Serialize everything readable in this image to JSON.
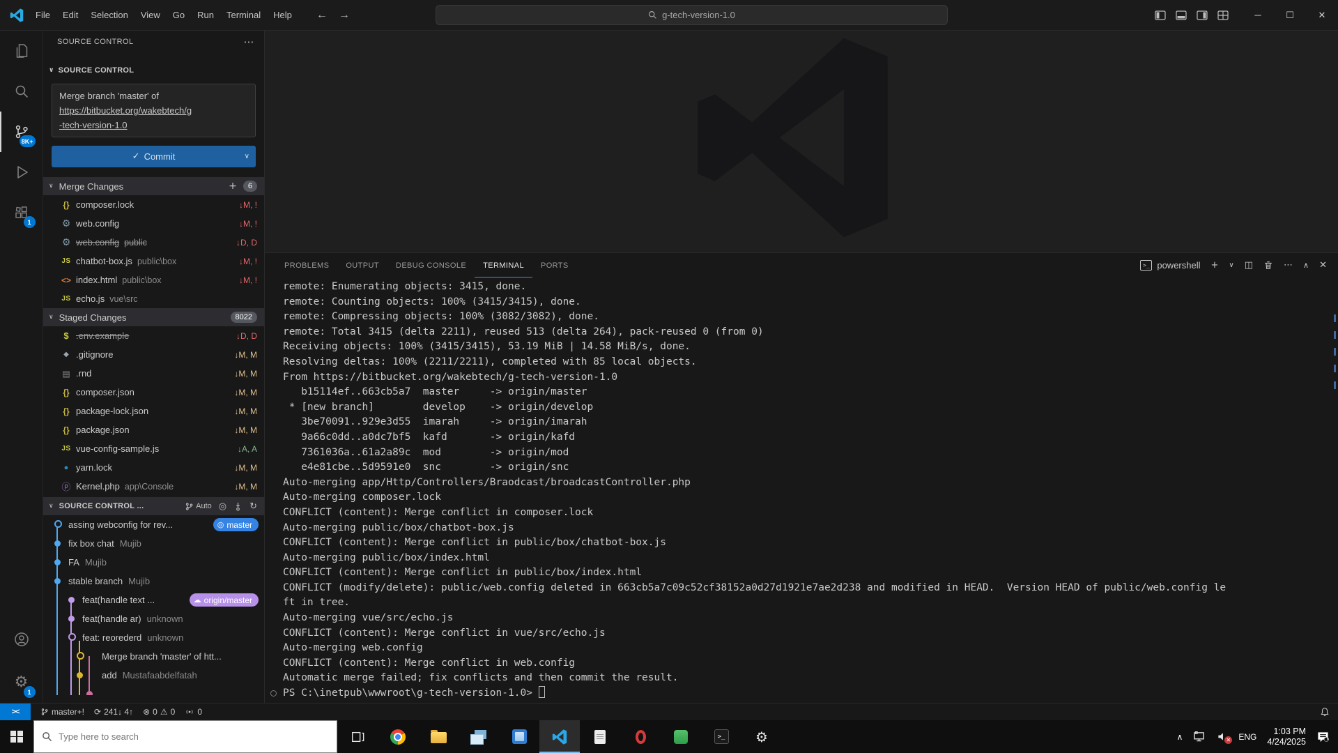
{
  "menus": [
    "File",
    "Edit",
    "Selection",
    "View",
    "Go",
    "Run",
    "Terminal",
    "Help"
  ],
  "window": {
    "search_value": "g-tech-version-1.0"
  },
  "glyphs": {
    "check": "✓",
    "chevron_down": "∨",
    "chevron_up": "∧",
    "more": "⋯",
    "add": "+",
    "back": "←",
    "forward": "→",
    "refresh": "↻",
    "target": "◎",
    "cloud": "☁",
    "gear": "⚙",
    "warning": "⚠",
    "error_circle": "⊗",
    "sync": "⟳",
    "close": "✕",
    "minimize": "─",
    "maximize": "☐",
    "split": "◫",
    "cmd_prompt": ">_"
  },
  "file_icons": {
    "braces": "{}",
    "gear": "⚙",
    "js": "JS",
    "html": "<>",
    "dollar": "$",
    "git": "◆",
    "file": "▤",
    "yarn": "●",
    "php": "ⓟ"
  },
  "colors": {
    "accent": "#0078d4",
    "conflict": "#e4676b",
    "deleted": "#e4676b",
    "modified": "#e2c08d",
    "added": "#81b88b",
    "ref_blue": "#3584e4",
    "ref_purple": "#b790ea",
    "lane_blue": "#4fa8f0",
    "lane_purple": "#c09aeb",
    "lane_yellow": "#ddb62f",
    "lane_magenta": "#d16d9e"
  },
  "activity_bar": {
    "scm_badge": "8K+",
    "extensions_badge": "1",
    "settings_badge": "1"
  },
  "sidebar": {
    "panel_title": "SOURCE CONTROL",
    "section_label": "SOURCE CONTROL",
    "commit_message": [
      "Merge branch 'master' of",
      "https://bitbucket.org/wakebtech/g",
      "-tech-version-1.0"
    ],
    "commit_button_label": "Commit",
    "sections": [
      {
        "label": "Merge Changes",
        "badge": "6",
        "show_add": true,
        "files": [
          {
            "icon": "braces",
            "name": "composer.lock",
            "desc": "",
            "marker": "↓M, !",
            "status": "conflict",
            "strike": false
          },
          {
            "icon": "gear",
            "name": "web.config",
            "desc": "",
            "marker": "↓M, !",
            "status": "conflict",
            "strike": false
          },
          {
            "icon": "gear",
            "name": "web.config",
            "desc": "public",
            "marker": "↓D, D",
            "status": "deleted",
            "strike": true
          },
          {
            "icon": "js",
            "name": "chatbot-box.js",
            "desc": "public\\box",
            "marker": "↓M, !",
            "status": "conflict",
            "strike": false
          },
          {
            "icon": "html",
            "name": "index.html",
            "desc": "public\\box",
            "marker": "↓M, !",
            "status": "conflict",
            "strike": false
          },
          {
            "icon": "js",
            "name": "echo.js",
            "desc": "vue\\src",
            "marker": "",
            "status": "none",
            "strike": false
          }
        ]
      },
      {
        "label": "Staged Changes",
        "badge": "8022",
        "show_add": false,
        "files": [
          {
            "icon": "dollar",
            "name": ".env.example",
            "desc": "",
            "marker": "↓D, D",
            "status": "deleted",
            "strike": true
          },
          {
            "icon": "git",
            "name": ".gitignore",
            "desc": "",
            "marker": "↓M, M",
            "status": "modified",
            "strike": false
          },
          {
            "icon": "file",
            "name": ".rnd",
            "desc": "",
            "marker": "↓M, M",
            "status": "modified",
            "strike": false
          },
          {
            "icon": "braces",
            "name": "composer.json",
            "desc": "",
            "marker": "↓M, M",
            "status": "modified",
            "strike": false
          },
          {
            "icon": "braces",
            "name": "package-lock.json",
            "desc": "",
            "marker": "↓M, M",
            "status": "modified",
            "strike": false
          },
          {
            "icon": "braces",
            "name": "package.json",
            "desc": "",
            "marker": "↓M, M",
            "status": "modified",
            "strike": false
          },
          {
            "icon": "js",
            "name": "vue-config-sample.js",
            "desc": "",
            "marker": "↓A, A",
            "status": "added",
            "strike": false
          },
          {
            "icon": "yarn",
            "name": "yarn.lock",
            "desc": "",
            "marker": "↓M, M",
            "status": "modified",
            "strike": false
          },
          {
            "icon": "php",
            "name": "Kernel.php",
            "desc": "app\\Console",
            "marker": "↓M, M",
            "status": "modified",
            "strike": false
          }
        ]
      }
    ],
    "graph": {
      "label": "SOURCE CONTROL ...",
      "auto_label": "Auto",
      "commits": [
        {
          "message": "assing webconfig for rev...",
          "author": "",
          "ref": "master",
          "ref_style": "ref_blue",
          "ref_icon": "target",
          "lane": 0,
          "dot": "open",
          "color": "lane_blue"
        },
        {
          "message": "fix box chat",
          "author": "Mujib",
          "lane": 0,
          "dot": "filled",
          "color": "lane_blue"
        },
        {
          "message": "FA",
          "author": "Mujib",
          "lane": 0,
          "dot": "filled",
          "color": "lane_blue"
        },
        {
          "message": "stable branch",
          "author": "Mujib",
          "lane": 0,
          "dot": "filled",
          "color": "lane_blue"
        },
        {
          "message": "feat(handle text ...",
          "author": "",
          "ref": "origin/master",
          "ref_style": "ref_purple",
          "ref_icon": "cloud",
          "lane": 1,
          "dot": "filled",
          "color": "lane_purple"
        },
        {
          "message": "feat(handle ar)",
          "author": "unknown",
          "lane": 1,
          "dot": "filled",
          "color": "lane_purple"
        },
        {
          "message": "feat: reorederd",
          "author": "unknown",
          "lane": 1,
          "dot": "open",
          "color": "lane_purple"
        },
        {
          "message": "Merge branch 'master' of htt...",
          "author": "",
          "lane": 2,
          "dot": "open",
          "color": "lane_yellow"
        },
        {
          "message": "add",
          "author": "Mustafaabdelfatah",
          "lane": 2,
          "dot": "filled",
          "color": "lane_yellow"
        },
        {
          "message": "",
          "author": "",
          "lane": 3,
          "dot": "filled",
          "color": "lane_magenta",
          "partial": true
        }
      ]
    }
  },
  "panel": {
    "tabs": [
      "PROBLEMS",
      "OUTPUT",
      "DEBUG CONSOLE",
      "TERMINAL",
      "PORTS"
    ],
    "active_tab": "TERMINAL",
    "shell_label": "powershell",
    "terminal_lines": [
      "remote: Enumerating objects: 3415, done.",
      "remote: Counting objects: 100% (3415/3415), done.",
      "remote: Compressing objects: 100% (3082/3082), done.",
      "remote: Total 3415 (delta 2211), reused 513 (delta 264), pack-reused 0 (from 0)",
      "Receiving objects: 100% (3415/3415), 53.19 MiB | 14.58 MiB/s, done.",
      "Resolving deltas: 100% (2211/2211), completed with 85 local objects.",
      "From https://bitbucket.org/wakebtech/g-tech-version-1.0",
      "   b15114ef..663cb5a7  master     -> origin/master",
      " * [new branch]        develop    -> origin/develop",
      "   3be70091..929e3d55  imarah     -> origin/imarah",
      "   9a66c0dd..a0dc7bf5  kafd       -> origin/kafd",
      "   7361036a..61a2a89c  mod        -> origin/mod",
      "   e4e81cbe..5d9591e0  snc        -> origin/snc",
      "Auto-merging app/Http/Controllers/Braodcast/broadcastController.php",
      "Auto-merging composer.lock",
      "CONFLICT (content): Merge conflict in composer.lock",
      "Auto-merging public/box/chatbot-box.js",
      "CONFLICT (content): Merge conflict in public/box/chatbot-box.js",
      "Auto-merging public/box/index.html",
      "CONFLICT (content): Merge conflict in public/box/index.html",
      "CONFLICT (modify/delete): public/web.config deleted in 663cb5a7c09c52cf38152a0d27d1921e7ae2d238 and modified in HEAD.  Version HEAD of public/web.config le",
      "ft in tree.",
      "Auto-merging vue/src/echo.js",
      "CONFLICT (content): Merge conflict in vue/src/echo.js",
      "Auto-merging web.config",
      "CONFLICT (content): Merge conflict in web.config",
      "Automatic merge failed; fix conflicts and then commit the result."
    ],
    "prompt": "PS C:\\inetpub\\wwwroot\\g-tech-version-1.0> "
  },
  "status_bar": {
    "remote_glyph": "><",
    "branch": "master+!",
    "sync": "241↓ 4↑",
    "errors": "0",
    "warnings": "0",
    "broadcast": "0"
  },
  "taskbar": {
    "search_placeholder": "Type here to search",
    "language": "ENG",
    "time": "1:03 PM",
    "date": "4/24/2025"
  }
}
